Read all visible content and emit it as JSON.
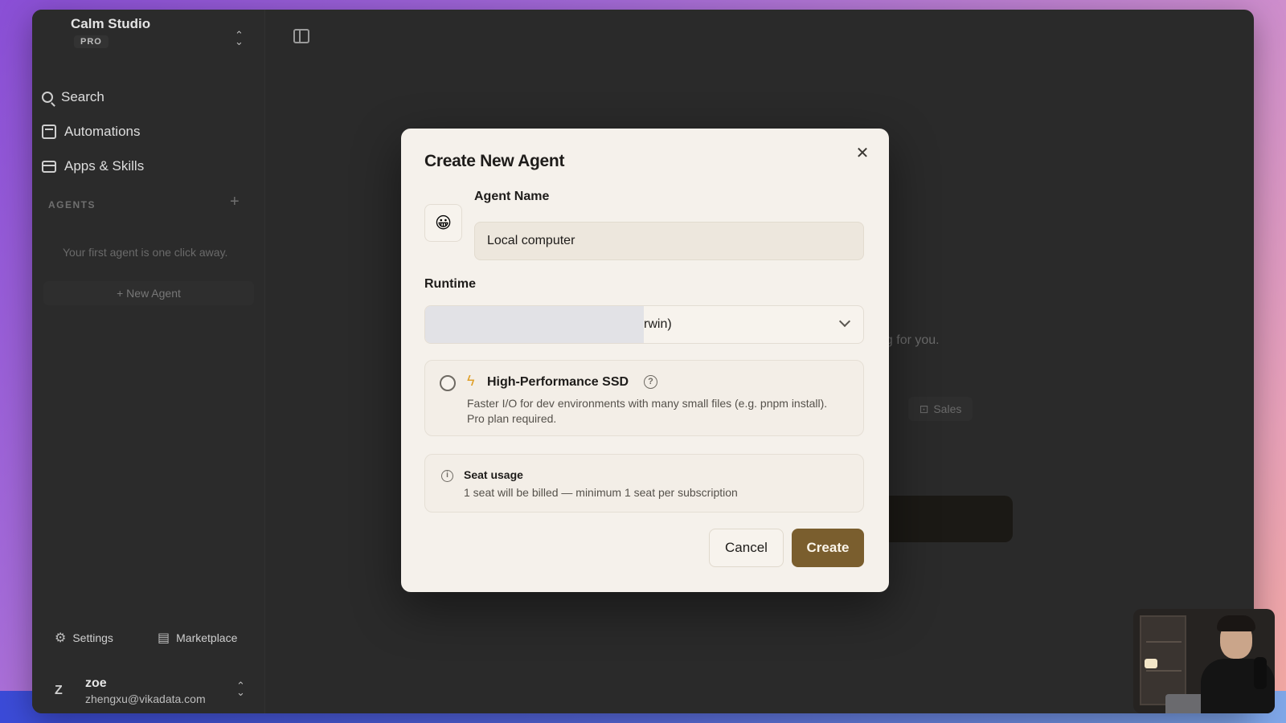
{
  "sidebar": {
    "org_name": "Calm Studio",
    "org_badge": "PRO",
    "nav": [
      {
        "label": "Search",
        "icon": "search-icon"
      },
      {
        "label": "Automations",
        "icon": "calendar-clock-icon"
      },
      {
        "label": "Apps & Skills",
        "icon": "app-window-icon"
      }
    ],
    "agents_header": "AGENTS",
    "empty_text": "Your first agent is one click away.",
    "new_agent": "+ New Agent",
    "footer": {
      "settings": "Settings",
      "marketplace": "Marketplace"
    },
    "user": {
      "initial": "Z",
      "name": "zoe",
      "email": "zhengxu@vikadata.com"
    }
  },
  "background": {
    "hint_text": "ng for you.",
    "chip_label": "Sales"
  },
  "modal": {
    "title": "Create New Agent",
    "emoji": "😀",
    "agent_name_label": "Agent Name",
    "agent_name_value": "Local computer",
    "runtime_label": "Runtime",
    "runtime_value": "rwin)",
    "ssd": {
      "title": "High-Performance SSD",
      "description": "Faster I/O for dev environments with many small files (e.g. pnpm install). Pro plan required.",
      "checked": false
    },
    "seat": {
      "title": "Seat usage",
      "description": "1 seat will be billed — minimum 1 seat per subscription"
    },
    "cancel_label": "Cancel",
    "create_label": "Create"
  },
  "colors": {
    "primary_button": "#7a5e2e",
    "modal_bg": "#f5f1eb",
    "app_bg": "#2a2a2a",
    "bolt": "#e0a02a"
  }
}
